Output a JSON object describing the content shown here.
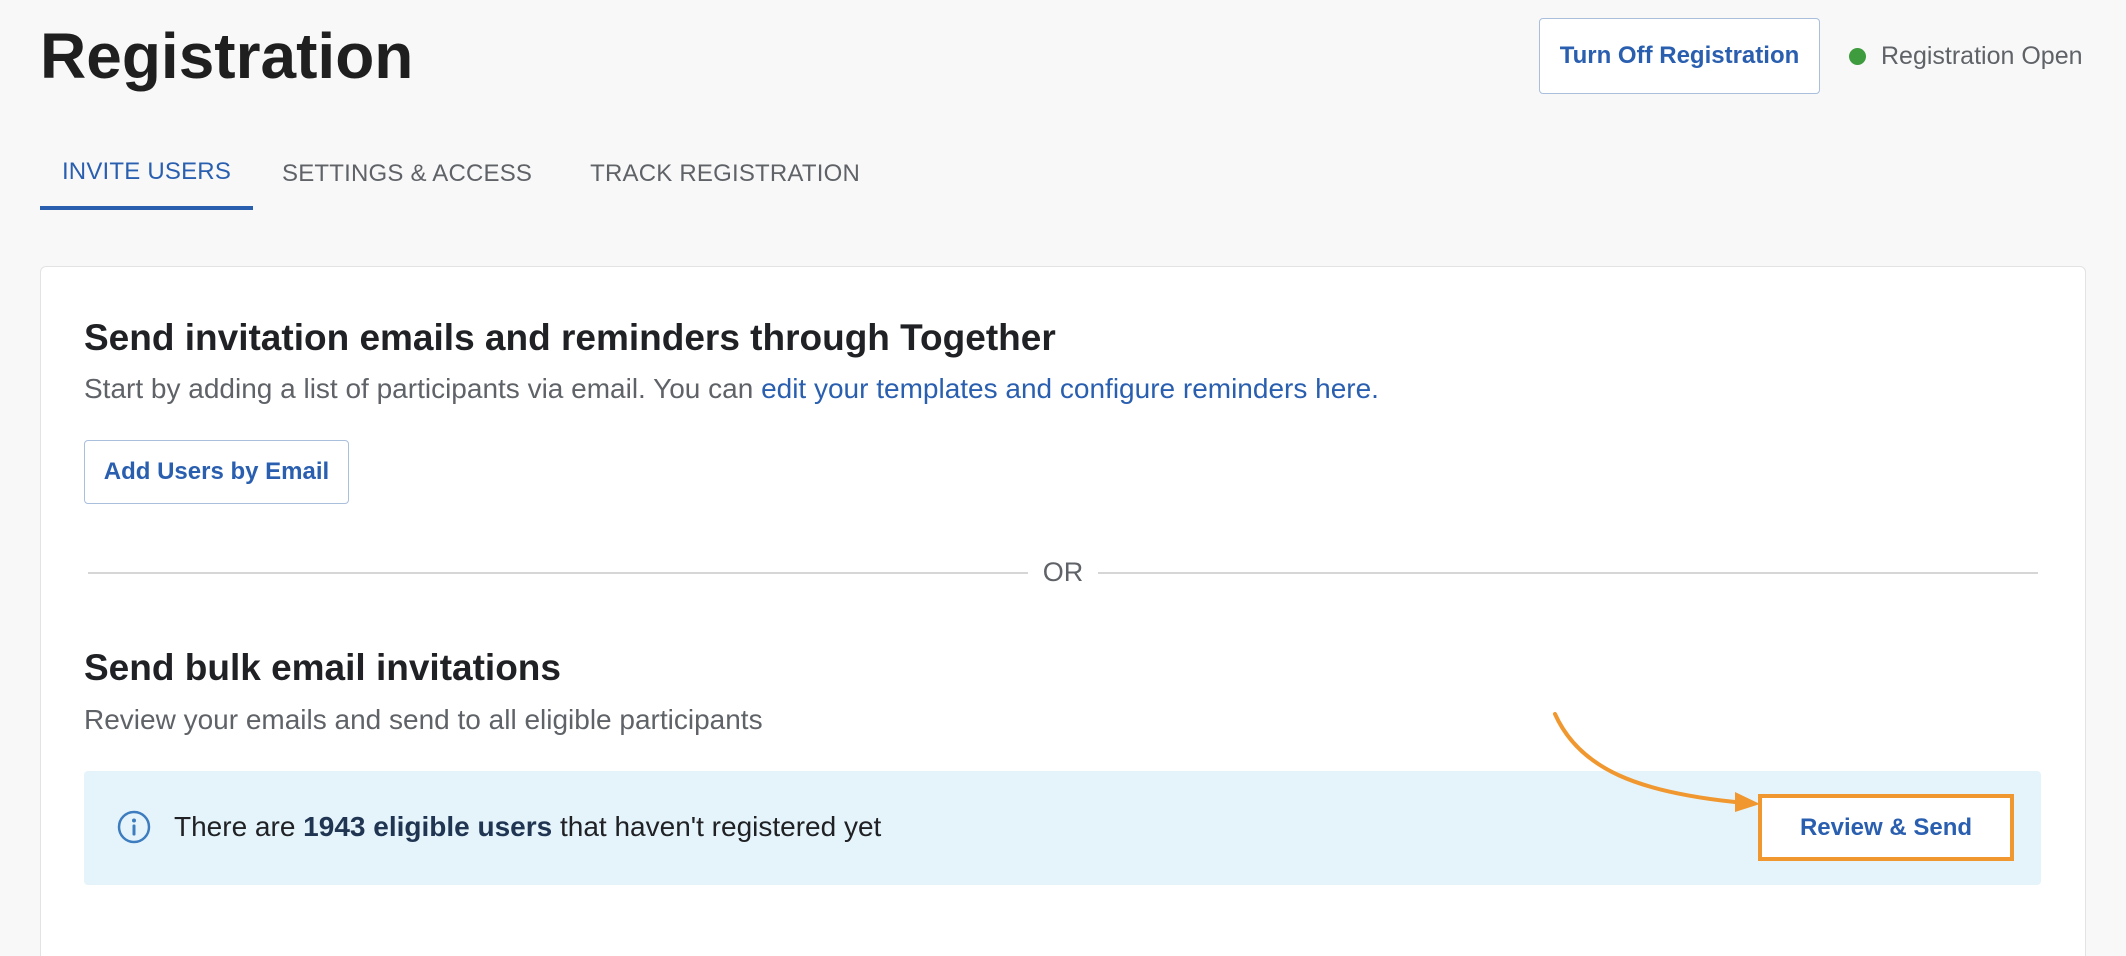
{
  "header": {
    "title": "Registration",
    "turn_off_label": "Turn Off Registration",
    "status_text": "Registration Open",
    "status_color": "#3e9b3e"
  },
  "tabs": [
    {
      "label": "INVITE USERS",
      "active": true
    },
    {
      "label": "SETTINGS & ACCESS",
      "active": false
    },
    {
      "label": "TRACK REGISTRATION",
      "active": false
    }
  ],
  "section_invite": {
    "heading": "Send invitation emails and reminders through Together",
    "description": "Start by adding a list of participants via email. You can ",
    "link_text": "edit your templates and configure reminders here.",
    "add_button": "Add Users by Email"
  },
  "divider": {
    "text": "OR"
  },
  "section_bulk": {
    "heading": "Send bulk email invitations",
    "description": "Review your emails and send to all eligible participants",
    "info_prefix": "There are ",
    "info_bold": "1943 eligible users",
    "info_suffix": " that haven't registered yet",
    "review_button": "Review & Send"
  },
  "icons": {
    "info": "info-icon",
    "status": "status-dot-icon",
    "annotation": "annotation-arrow-icon"
  },
  "colors": {
    "accent": "#2a5fb0",
    "highlight": "#f0982f",
    "banner_bg": "#e5f4fb"
  }
}
